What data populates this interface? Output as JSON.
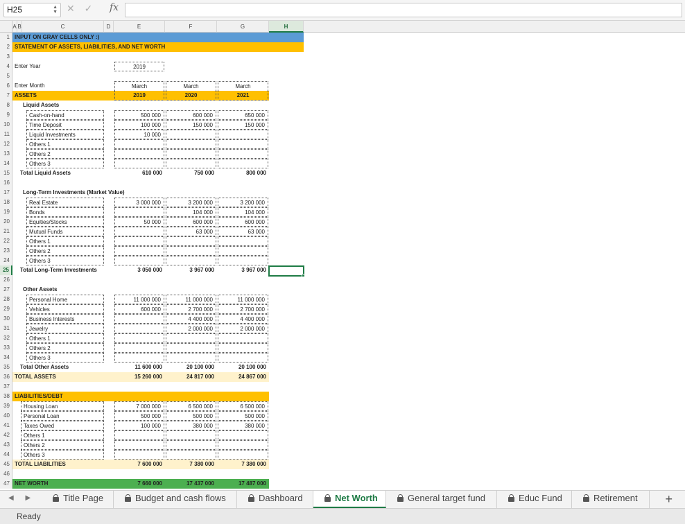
{
  "formula_bar": {
    "name_box": "H25",
    "cancel_glyph": "✕",
    "confirm_glyph": "✓",
    "fx_label": "fx",
    "formula": ""
  },
  "columns": [
    "A",
    "B",
    "C",
    "D",
    "E",
    "F",
    "G",
    "H"
  ],
  "selected": {
    "column": "H",
    "row": "25",
    "cell": "H25"
  },
  "sheet": {
    "r1": "INPUT ON GRAY CELLS ONLY :)",
    "r2": "STATEMENT OF ASSETS, LIABILITIES, AND NET WORTH",
    "r4_label": "Enter Year",
    "r4_year": "2019",
    "r6_label": "Enter Month",
    "months": [
      "March",
      "March",
      "March"
    ],
    "r7_label": "ASSETS",
    "years": [
      "2019",
      "2020",
      "2021"
    ],
    "liquid_title": "Liquid Assets",
    "liquid": [
      {
        "label": "Cash-on-hand",
        "v": [
          "500 000",
          "600 000",
          "650 000"
        ]
      },
      {
        "label": "Time Deposit",
        "v": [
          "100 000",
          "150 000",
          "150 000"
        ]
      },
      {
        "label": "Liquid Investments",
        "v": [
          "10 000",
          "",
          ""
        ]
      },
      {
        "label": "Others 1",
        "v": [
          "",
          "",
          ""
        ]
      },
      {
        "label": "Others 2",
        "v": [
          "",
          "",
          ""
        ]
      },
      {
        "label": "Others 3",
        "v": [
          "",
          "",
          ""
        ]
      }
    ],
    "total_liquid": {
      "label": "Total Liquid Assets",
      "v": [
        "610 000",
        "750 000",
        "800 000"
      ]
    },
    "lt_title": "Long-Term Investments (Market Value)",
    "lt": [
      {
        "label": "Real Estate",
        "v": [
          "3 000 000",
          "3 200 000",
          "3 200 000"
        ]
      },
      {
        "label": "Bonds",
        "v": [
          "",
          "104 000",
          "104 000"
        ]
      },
      {
        "label": "Equities/Stocks",
        "v": [
          "50 000",
          "600 000",
          "600 000"
        ]
      },
      {
        "label": "Mutual Funds",
        "v": [
          "",
          "63 000",
          "63 000"
        ]
      },
      {
        "label": "Others 1",
        "v": [
          "",
          "",
          ""
        ]
      },
      {
        "label": "Others 2",
        "v": [
          "",
          "",
          ""
        ]
      },
      {
        "label": "Others 3",
        "v": [
          "",
          "",
          ""
        ]
      }
    ],
    "total_lt": {
      "label": "Total Long-Term Investments",
      "v": [
        "3 050 000",
        "3 967 000",
        "3 967 000"
      ]
    },
    "other_title": "Other Assets",
    "other": [
      {
        "label": "Personal Home",
        "v": [
          "11 000 000",
          "11 000 000",
          "11 000 000"
        ]
      },
      {
        "label": "Vehicles",
        "v": [
          "600 000",
          "2 700 000",
          "2 700 000"
        ]
      },
      {
        "label": "Business Interests",
        "v": [
          "",
          "4 400 000",
          "4 400 000"
        ]
      },
      {
        "label": "Jewelry",
        "v": [
          "",
          "2 000 000",
          "2 000 000"
        ]
      },
      {
        "label": "Others 1",
        "v": [
          "",
          "",
          ""
        ]
      },
      {
        "label": "Others 2",
        "v": [
          "",
          "",
          ""
        ]
      },
      {
        "label": "Others 3",
        "v": [
          "",
          "",
          ""
        ]
      }
    ],
    "total_other": {
      "label": "Total Other Assets",
      "v": [
        "11 600 000",
        "20 100 000",
        "20 100 000"
      ]
    },
    "total_assets": {
      "label": "TOTAL ASSETS",
      "v": [
        "15 260 000",
        "24 817 000",
        "24 867 000"
      ]
    },
    "liab_title": "LIABILITIES/DEBT",
    "liab": [
      {
        "label": "Housing Loan",
        "v": [
          "7 000 000",
          "6 500 000",
          "6 500 000"
        ]
      },
      {
        "label": "Personal Loan",
        "v": [
          "500 000",
          "500 000",
          "500 000"
        ]
      },
      {
        "label": "Taxes Owed",
        "v": [
          "100 000",
          "380 000",
          "380 000"
        ]
      },
      {
        "label": "Others 1",
        "v": [
          "",
          "",
          ""
        ]
      },
      {
        "label": "Others 2",
        "v": [
          "",
          "",
          ""
        ]
      },
      {
        "label": "Others 3",
        "v": [
          "",
          "",
          ""
        ]
      }
    ],
    "total_liab": {
      "label": "TOTAL LIABILITIES",
      "v": [
        "7 600 000",
        "7 380 000",
        "7 380 000"
      ]
    },
    "net_worth": {
      "label": "NET WORTH",
      "v": [
        "7 660 000",
        "17 437 000",
        "17 487 000"
      ]
    }
  },
  "tabs": [
    {
      "label": "Title Page",
      "active": false
    },
    {
      "label": "Budget and cash flows",
      "active": false
    },
    {
      "label": "Dashboard",
      "active": false
    },
    {
      "label": "Net Worth",
      "active": true
    },
    {
      "label": "General target fund",
      "active": false
    },
    {
      "label": "Educ Fund",
      "active": false
    },
    {
      "label": "Retirement",
      "active": false
    }
  ],
  "status": {
    "text": "Ready"
  },
  "colors": {
    "accent": "#1e7b45",
    "blue_band": "#5b9bd5",
    "orange_band": "#ffc000",
    "cream_band": "#fff2cc",
    "green_band": "#4caf50"
  }
}
